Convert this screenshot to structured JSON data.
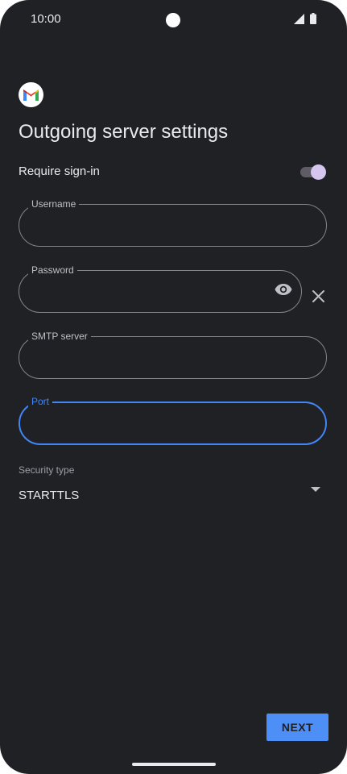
{
  "status_bar": {
    "time": "10:00",
    "icons": [
      "signal-icon",
      "battery-icon"
    ]
  },
  "app": {
    "logo": "gmail-logo"
  },
  "page": {
    "title": "Outgoing server settings"
  },
  "require_signin": {
    "label": "Require sign-in",
    "enabled": true
  },
  "fields": {
    "username": {
      "label": "Username",
      "value": ""
    },
    "password": {
      "label": "Password",
      "value": ""
    },
    "smtp_server": {
      "label": "SMTP server",
      "value": ""
    },
    "port": {
      "label": "Port",
      "value": ""
    }
  },
  "security": {
    "label": "Security type",
    "value": "STARTTLS"
  },
  "footer": {
    "next_label": "NEXT"
  },
  "colors": {
    "background": "#202124",
    "accent": "#4285f4",
    "button": "#4e8ef7",
    "toggle_thumb": "#d5c6ef"
  }
}
